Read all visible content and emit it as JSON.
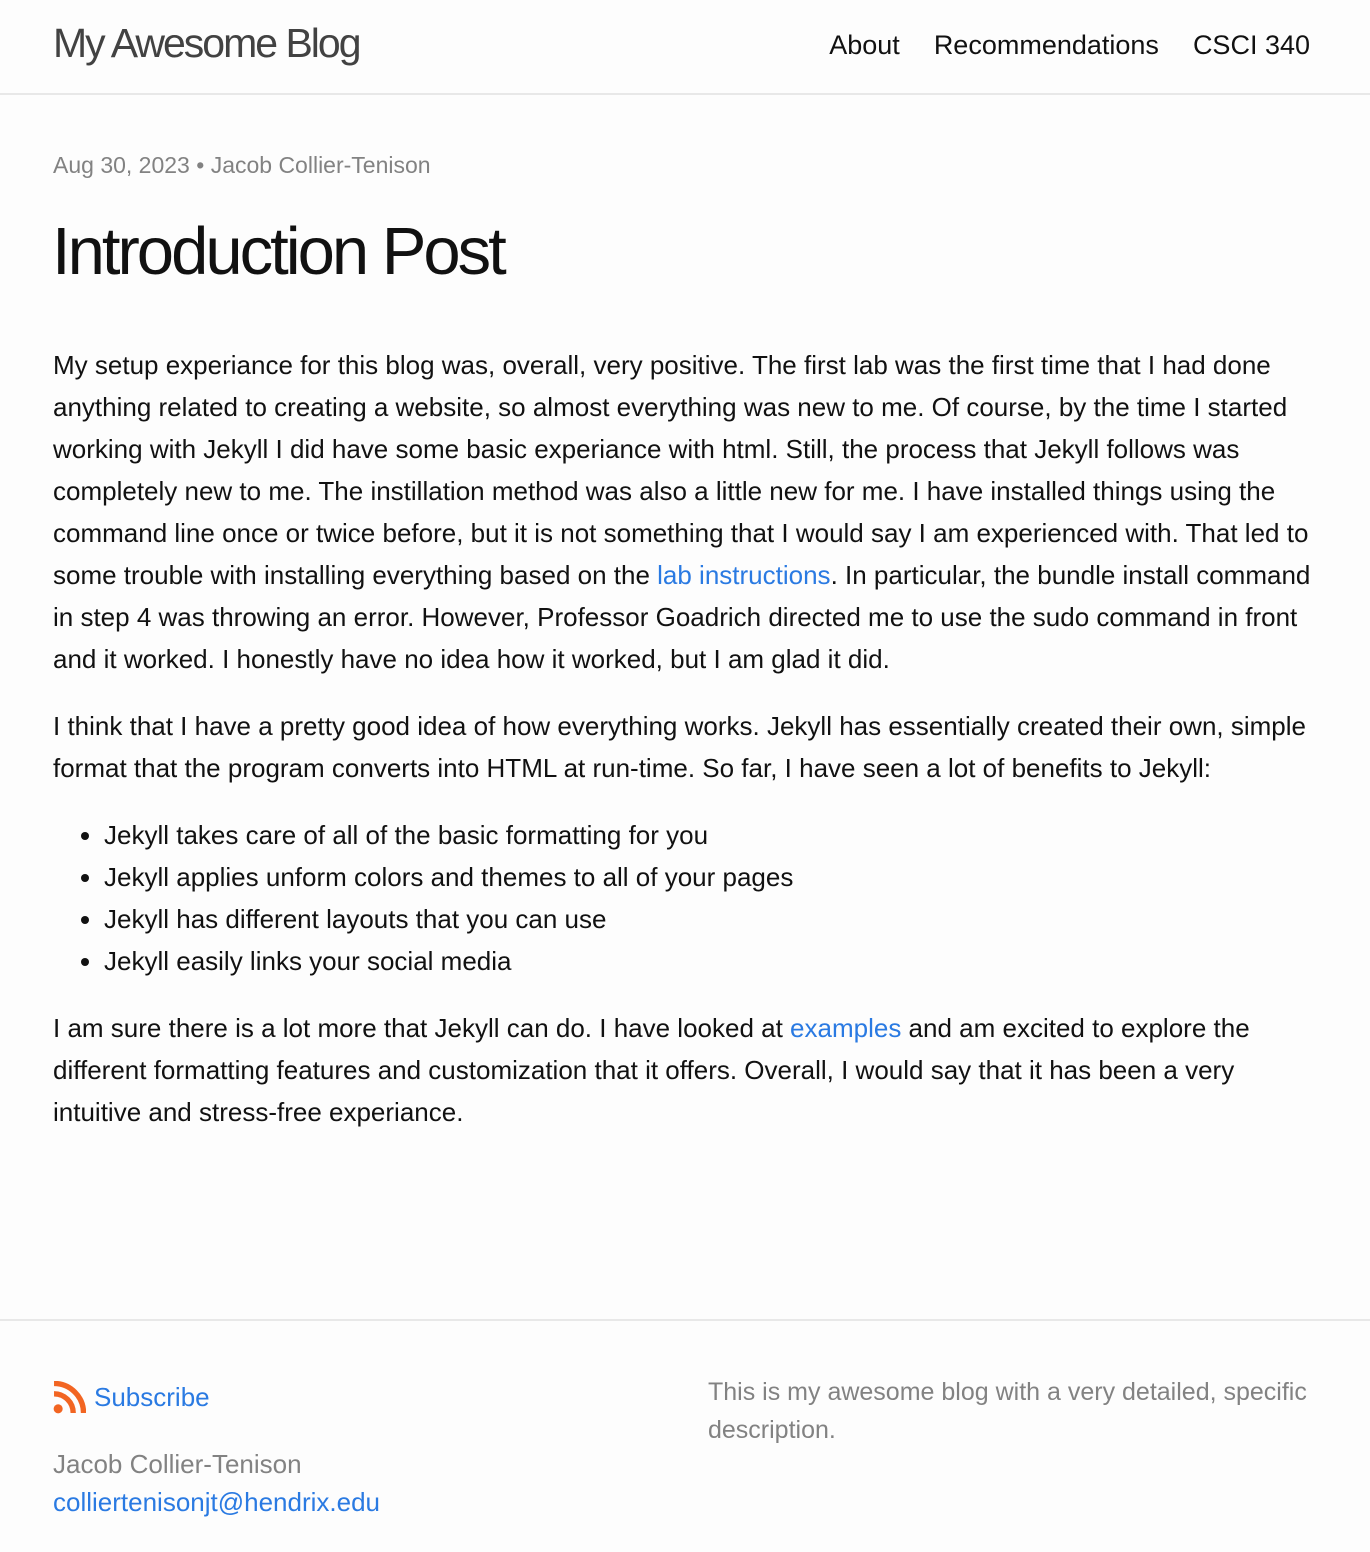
{
  "header": {
    "site_title": "My Awesome Blog",
    "nav": [
      {
        "label": "About"
      },
      {
        "label": "Recommendations"
      },
      {
        "label": "CSCI 340"
      }
    ]
  },
  "post": {
    "date": "Aug 30, 2023",
    "separator": "•",
    "author": "Jacob Collier-Tenison",
    "title": "Introduction Post",
    "p1_before": "My setup experiance for this blog was, overall, very positive. The first lab was the first time that I had done anything related to creating a website, so almost everything was new to me. Of course, by the time I started working with Jekyll I did have some basic experiance with html. Still, the process that Jekyll follows was completely new to me. The instillation method was also a little new for me. I have installed things using the command line once or twice before, but it is not something that I would say I am experienced with. That led to some trouble with installing everything based on the ",
    "p1_link": "lab instructions",
    "p1_after": ". In particular, the bundle install command in step 4 was throwing an error. However, Professor Goadrich directed me to use the sudo command in front and it worked. I honestly have no idea how it worked, but I am glad it did.",
    "p2": "I think that I have a pretty good idea of how everything works. Jekyll has essentially created their own, simple format that the program converts into HTML at run-time. So far, I have seen a lot of benefits to Jekyll:",
    "list": [
      "Jekyll takes care of all of the basic formatting for you",
      "Jekyll applies unform colors and themes to all of your pages",
      "Jekyll has different layouts that you can use",
      "Jekyll easily links your social media"
    ],
    "p3_before": "I am sure there is a lot more that Jekyll can do. I have looked at ",
    "p3_link": "examples",
    "p3_after": " and am excited to explore the different formatting features and customization that it offers. Overall, I would say that it has been a very intuitive and stress-free experiance."
  },
  "footer": {
    "subscribe_label": "Subscribe",
    "name": "Jacob Collier-Tenison",
    "email": "colliertenisonjt@hendrix.edu",
    "description": "This is my awesome blog with a very detailed, specific description."
  },
  "colors": {
    "link": "#2a7ae2",
    "meta": "#828282",
    "rss": "#f26522"
  },
  "icons": {
    "subscribe": "rss-icon"
  }
}
